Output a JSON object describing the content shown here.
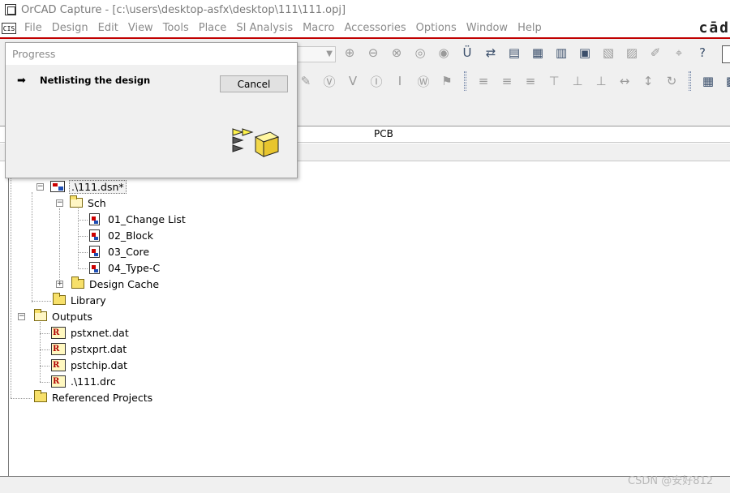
{
  "window": {
    "title": "OrCAD Capture - [c:\\users\\desktop-asfx\\desktop\\111\\111.opj]"
  },
  "menu": {
    "doc_icon_text": "CIS",
    "items": [
      "File",
      "Design",
      "Edit",
      "View",
      "Tools",
      "Place",
      "SI Analysis",
      "Macro",
      "Accessories",
      "Options",
      "Window",
      "Help"
    ],
    "logo": "cād"
  },
  "project_header": {
    "pcb_tab": "PCB"
  },
  "tree": {
    "design": ".\\111.dsn*",
    "sch_folder": "Sch",
    "pages": [
      "01_Change List",
      "02_Block",
      "03_Core",
      "04_Type-C"
    ],
    "design_cache": "Design Cache",
    "library": "Library",
    "outputs": "Outputs",
    "output_files": [
      "pstxnet.dat",
      "pstxprt.dat",
      "pstchip.dat",
      ".\\111.drc"
    ],
    "referenced_projects": "Referenced Projects",
    "report_icon_glyph": "R"
  },
  "dialog": {
    "title": "Progress",
    "message": "Netlisting the design",
    "cancel_label": "Cancel"
  },
  "watermark": "CSDN @安好812",
  "colors": {
    "accent_red": "#c00000",
    "folder_yellow": "#f7e06a"
  }
}
